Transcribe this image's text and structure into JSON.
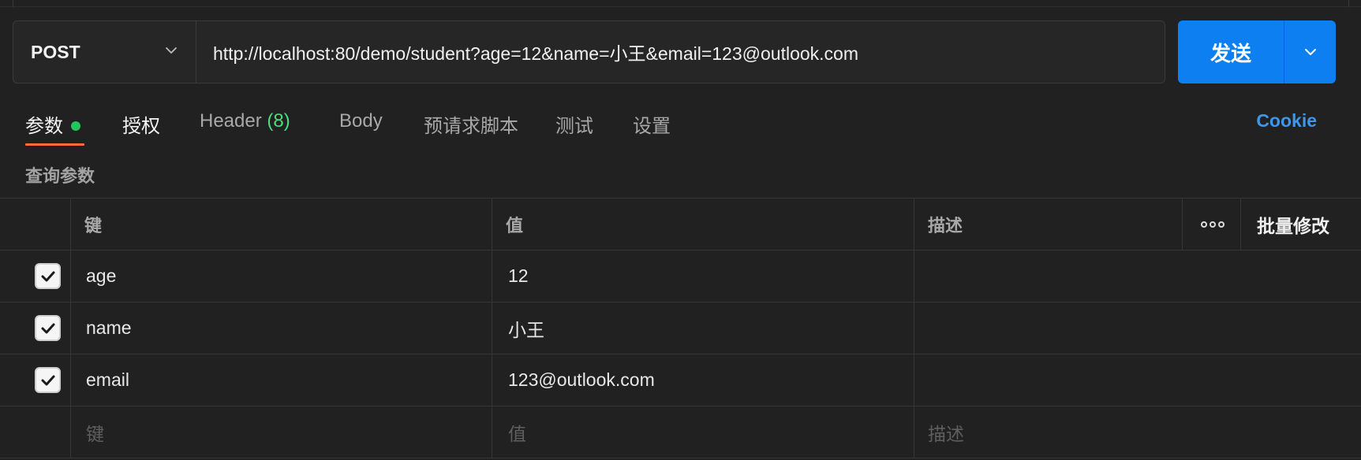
{
  "request": {
    "method": "POST",
    "url": "http://localhost:80/demo/student?age=12&name=小王&email=123@outlook.com",
    "send_label": "发送"
  },
  "tabs": {
    "params": "参数",
    "auth": "授权",
    "header_label": "Header",
    "header_count": "(8)",
    "body": "Body",
    "prerequest": "预请求脚本",
    "tests": "测试",
    "settings": "设置",
    "cookie": "Cookie"
  },
  "section_title": "查询参数",
  "table": {
    "headers": {
      "key": "键",
      "value": "值",
      "description": "描述",
      "bulk_edit": "批量修改"
    },
    "rows": [
      {
        "checked": true,
        "key": "age",
        "value": "12",
        "description": ""
      },
      {
        "checked": true,
        "key": "name",
        "value": "小王",
        "description": ""
      },
      {
        "checked": true,
        "key": "email",
        "value": "123@outlook.com",
        "description": ""
      }
    ],
    "placeholders": {
      "key": "键",
      "value": "值",
      "description": "描述"
    }
  },
  "colors": {
    "accent": "#0d7ff1",
    "tab_underline": "#ff6c37",
    "status_dot": "#22c55e",
    "cookie_link": "#3e97ea"
  }
}
